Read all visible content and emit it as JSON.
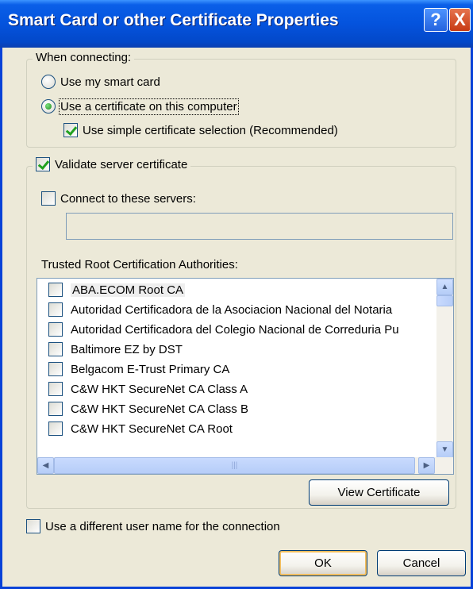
{
  "window": {
    "title": "Smart Card or other Certificate Properties",
    "help_icon": "?",
    "close_icon": "X"
  },
  "when_connecting": {
    "legend": "When connecting:",
    "smart_card": {
      "label": "Use my smart card",
      "selected": false
    },
    "certificate": {
      "label": "Use a certificate on this computer",
      "selected": true
    },
    "simple_selection": {
      "label": "Use simple certificate selection (Recommended)",
      "checked": true
    }
  },
  "validation": {
    "validate_label": "Validate server certificate",
    "validate_checked": true,
    "connect_label": "Connect to these servers:",
    "connect_checked": false,
    "servers_value": "",
    "trusted_label": "Trusted Root Certification Authorities:",
    "authorities": [
      {
        "label": "ABA.ECOM Root CA",
        "checked": false
      },
      {
        "label": "Autoridad Certificadora de la Asociacion Nacional del Notaria",
        "checked": false
      },
      {
        "label": "Autoridad Certificadora del Colegio Nacional de Correduria Pu",
        "checked": false
      },
      {
        "label": "Baltimore EZ by DST",
        "checked": false
      },
      {
        "label": "Belgacom E-Trust Primary CA",
        "checked": false
      },
      {
        "label": "C&W HKT SecureNet CA Class A",
        "checked": false
      },
      {
        "label": "C&W HKT SecureNet CA Class B",
        "checked": false
      },
      {
        "label": "C&W HKT SecureNet CA Root",
        "checked": false
      }
    ],
    "view_certificate": "View Certificate"
  },
  "different_user": {
    "label": "Use a different user name for the connection",
    "checked": false
  },
  "buttons": {
    "ok": "OK",
    "cancel": "Cancel"
  },
  "colors": {
    "titlebar": "#0453dd",
    "dialog_bg": "#ece9d8",
    "check_mark": "#21a121",
    "close_button": "#c73a13"
  }
}
